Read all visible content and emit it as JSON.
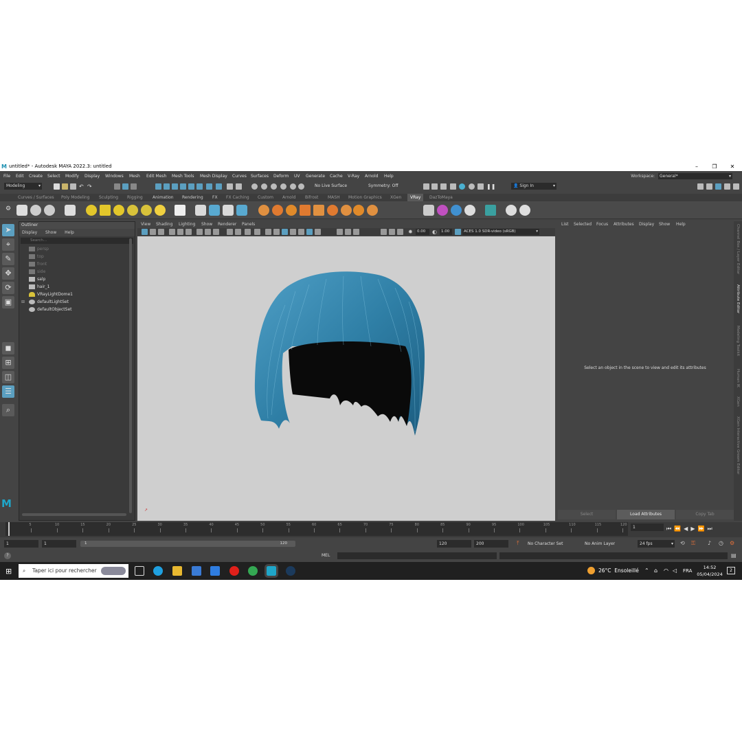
{
  "window": {
    "title": "untitled* - Autodesk MAYA 2022.3: untitled",
    "logo": "M"
  },
  "menubar": {
    "items": [
      "File",
      "Edit",
      "Create",
      "Select",
      "Modify",
      "Display",
      "Windows",
      "Mesh",
      "Edit Mesh",
      "Mesh Tools",
      "Mesh Display",
      "Curves",
      "Surfaces",
      "Deform",
      "UV",
      "Generate",
      "Cache",
      "V-Ray",
      "Arnold",
      "Help"
    ],
    "workspace_label": "Workspace:",
    "workspace_value": "General*"
  },
  "statusline": {
    "mode": "Modeling",
    "live_surface": "No Live Surface",
    "symmetry": "Symmetry: Off",
    "sign_in": "Sign In"
  },
  "shelf": {
    "tabs": [
      "Curves / Surfaces",
      "Poly Modeling",
      "Sculpting",
      "Rigging",
      "Animation",
      "Rendering",
      "FX",
      "FX Caching",
      "Custom",
      "Arnold",
      "Bifrost",
      "MASH",
      "Motion Graphics",
      "XGen",
      "VRay",
      "DazToMaya"
    ],
    "active_tab": "VRay"
  },
  "outliner": {
    "title": "Outliner",
    "menu": [
      "Display",
      "Show",
      "Help"
    ],
    "search_placeholder": "Search...",
    "items": [
      {
        "label": "persp",
        "dim": true
      },
      {
        "label": "top",
        "dim": true
      },
      {
        "label": "front",
        "dim": true
      },
      {
        "label": "side",
        "dim": true
      },
      {
        "label": "salp",
        "dim": false
      },
      {
        "label": "hair_1",
        "dim": false
      },
      {
        "label": "VRayLightDome1",
        "dim": false
      },
      {
        "label": "defaultLightSet",
        "dim": false
      },
      {
        "label": "defaultObjectSet",
        "dim": false
      }
    ]
  },
  "viewport": {
    "menu": [
      "View",
      "Shading",
      "Lighting",
      "Show",
      "Renderer",
      "Panels"
    ],
    "exposure": "0.00",
    "gamma": "1.00",
    "color_space": "ACES 1.0 SDR-video (sRGB)",
    "hair_color": "#2f7fa6",
    "background": "#cfcfcf"
  },
  "attribute_editor": {
    "menu": [
      "List",
      "Selected",
      "Focus",
      "Attributes",
      "Display",
      "Show",
      "Help"
    ],
    "message": "Select an object in the scene to view and edit its attributes",
    "buttons": [
      "Select",
      "Load Attributes",
      "Copy Tab"
    ]
  },
  "side_tabs": [
    "Channel Box / Layer Editor",
    "Attribute Editor",
    "Modeling Toolkit",
    "Human IK",
    "XGen",
    "XGen Interactive Groom Editor"
  ],
  "timeline": {
    "ticks": [
      "5",
      "10",
      "15",
      "20",
      "25",
      "30",
      "35",
      "40",
      "45",
      "50",
      "55",
      "60",
      "65",
      "70",
      "75",
      "80",
      "85",
      "90",
      "95",
      "100",
      "105",
      "110",
      "115",
      "120"
    ],
    "current_frame": "1"
  },
  "range": {
    "start": "1",
    "playback_start": "1",
    "slider_start": "1",
    "slider_end": "120",
    "playback_end": "120",
    "end": "200",
    "character_set": "No Character Set",
    "anim_layer": "No Anim Layer",
    "fps": "24 fps"
  },
  "cmdline": {
    "language": "MEL"
  },
  "taskbar": {
    "search_placeholder": "Taper ici pour rechercher",
    "weather": "26°C  Ensoleillé",
    "language": "FRA",
    "time": "14:52",
    "date": "05/04/2024",
    "notifications": "2"
  }
}
